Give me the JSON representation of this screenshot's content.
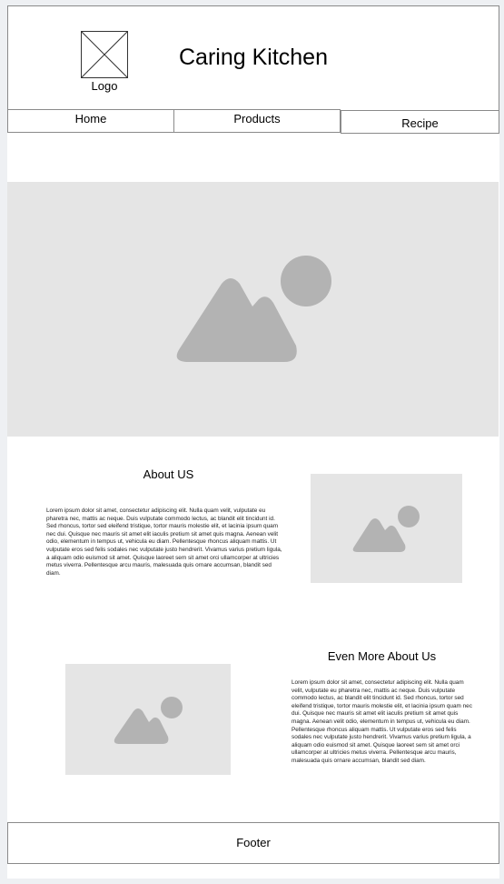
{
  "header": {
    "logo_label": "Logo",
    "site_title": "Caring Kitchen"
  },
  "nav": {
    "items": [
      {
        "label": "Home"
      },
      {
        "label": "Products"
      },
      {
        "label": "Recipe"
      }
    ]
  },
  "about": {
    "title": "About US",
    "body": "Lorem ipsum dolor sit amet, consectetur adipiscing elit. Nulla quam velit, vulputate eu pharetra nec, mattis ac neque. Duis vulputate commodo lectus, ac blandit elit tincidunt id. Sed rhoncus, tortor sed eleifend tristique, tortor mauris molestie elit, et lacinia ipsum quam nec dui. Quisque nec mauris sit amet elit iaculis pretium sit amet quis magna. Aenean velit odio, elementum in tempus ut, vehicula eu diam. Pellentesque rhoncus aliquam mattis. Ut vulputate eros sed felis sodales nec vulputate justo hendrerit. Vivamus varius pretium ligula, a aliquam odio euismod sit amet. Quisque laoreet sem sit amet orci ullamcorper at ultricies metus viverra. Pellentesque arcu mauris, malesuada quis ornare accumsan, blandit sed diam."
  },
  "more_about": {
    "title": "Even More About Us",
    "body": "Lorem ipsum dolor sit amet, consectetur adipiscing elit. Nulla quam velit, vulputate eu pharetra nec, mattis ac neque. Duis vulputate commodo lectus, ac blandit elit tincidunt id. Sed rhoncus, tortor sed eleifend tristique, tortor mauris molestie elit, et lacinia ipsum quam nec dui. Quisque nec mauris sit amet elit iaculis pretium sit amet quis magna. Aenean velit odio, elementum in tempus ut, vehicula eu diam. Pellentesque rhoncus aliquam mattis. Ut vulputate eros sed felis sodales nec vulputate justo hendrerit. Vivamus varius pretium ligula, a aliquam odio euismod sit amet. Quisque laoreet sem sit amet orci ullamcorper at ultricies metus viverra. Pellentesque arcu mauris, malesuada quis ornare accumsan, blandit sed diam."
  },
  "footer": {
    "label": "Footer"
  },
  "icons": {
    "logo_placeholder": "x-box-icon",
    "image_placeholder": "mountain-sun-image-icon"
  },
  "colors": {
    "placeholder_bg": "#e5e5e5",
    "placeholder_icon": "#b3b3b3",
    "border": "#8a8a8a"
  }
}
